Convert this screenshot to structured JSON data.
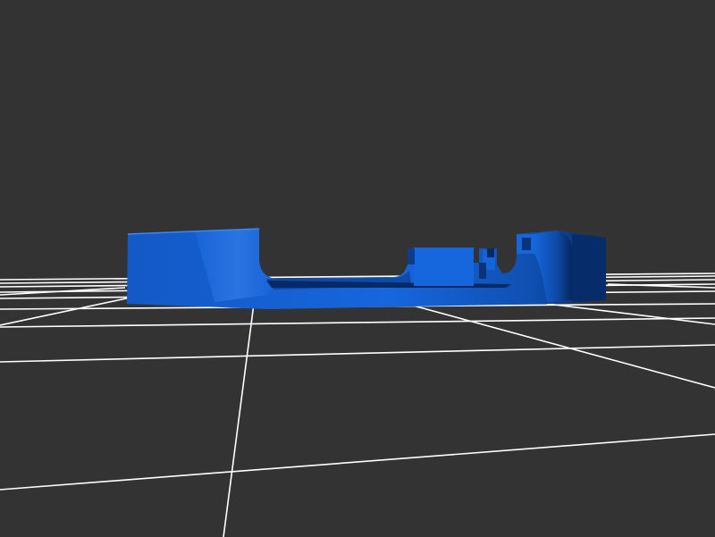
{
  "viewer": {
    "background_color": "#333333",
    "grid_color": "#ffffff",
    "model_color": "#1565d8",
    "model_shadow_color": "#0b3d8c",
    "model_dark_color": "#062a66",
    "model_highlight_color": "#3b86f0"
  },
  "scene": {
    "model_name": "3d-print-part",
    "grid": "ground-plane"
  }
}
